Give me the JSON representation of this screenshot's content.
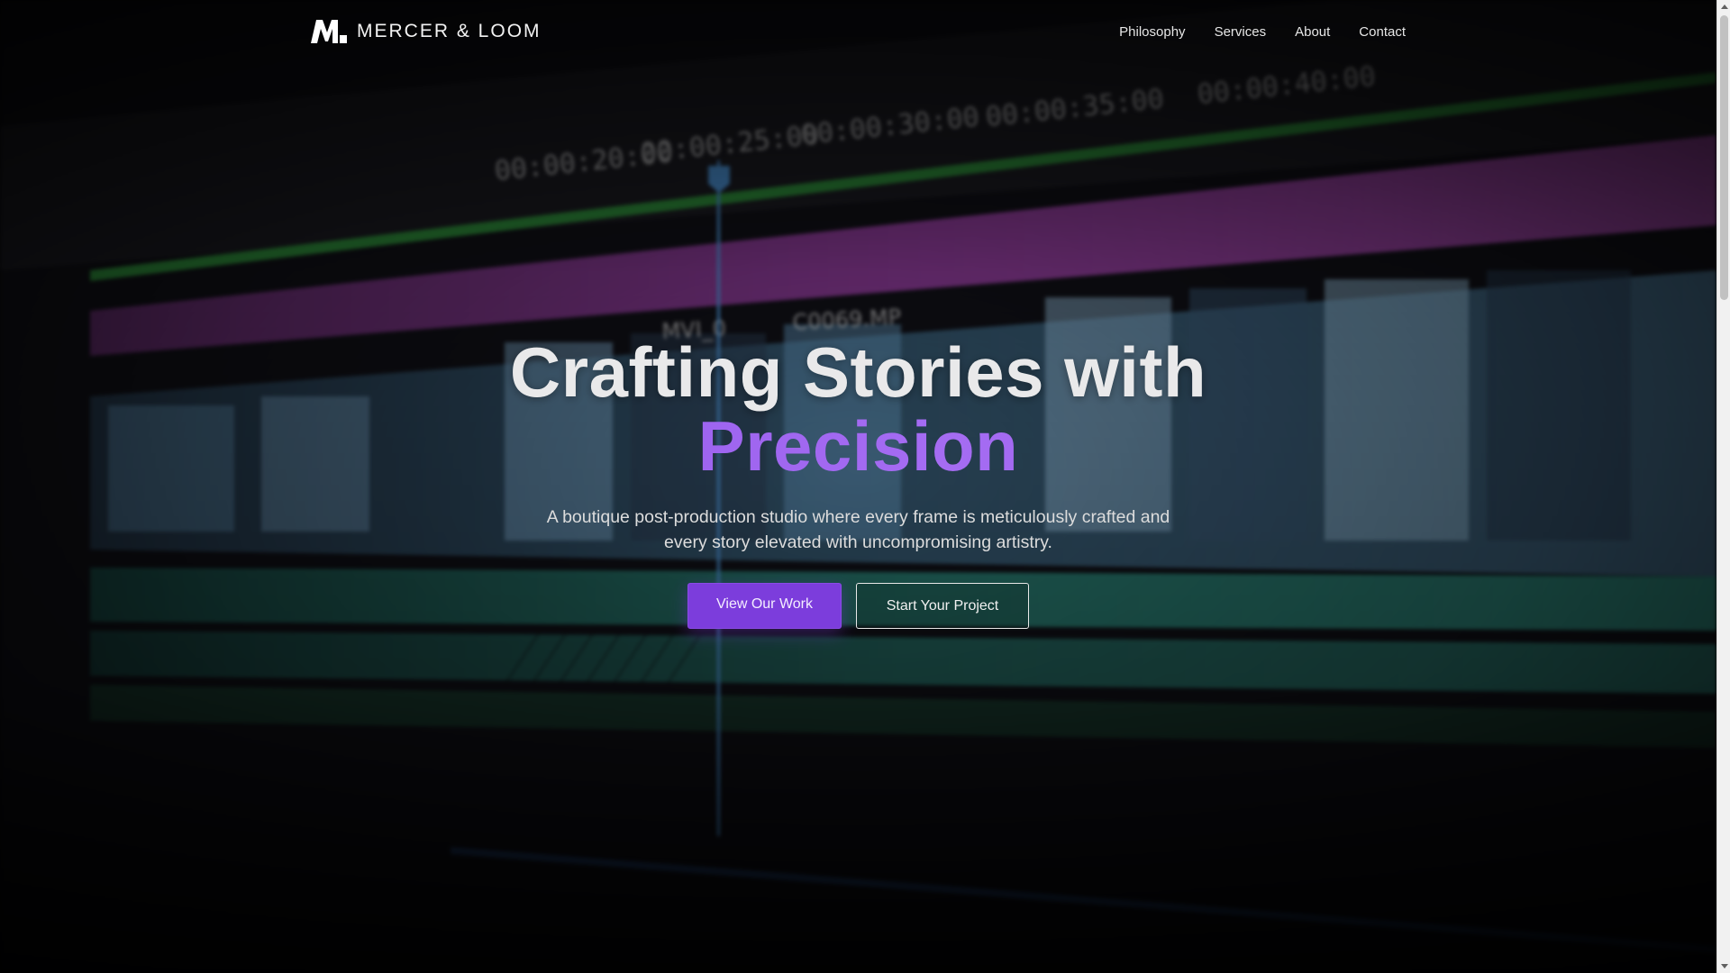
{
  "header": {
    "brand_name": "MERCER & LOOM",
    "logo_icon": "ml-monogram-icon",
    "nav": [
      {
        "label": "Philosophy"
      },
      {
        "label": "Services"
      },
      {
        "label": "About"
      },
      {
        "label": "Contact"
      }
    ]
  },
  "hero": {
    "title_line1": "Crafting Stories with",
    "title_accent": "Precision",
    "subtitle": "A boutique post-production studio where every frame is meticulously crafted and every story elevated with uncompromising artistry.",
    "primary_cta": "View Our Work",
    "secondary_cta": "Start Your Project",
    "background": {
      "subject": "video-editing-timeline",
      "timecodes": [
        "00:00:20:00",
        "00:00:25:00",
        "00:00:30:00",
        "00:00:35:00",
        "00:00:40:00"
      ],
      "clip_labels": [
        "MVI_0",
        "C0069.MP"
      ]
    }
  },
  "colors": {
    "accent": "#7c3ddc",
    "accent_text": "#a56cf2",
    "background": "#0a0a0d"
  }
}
